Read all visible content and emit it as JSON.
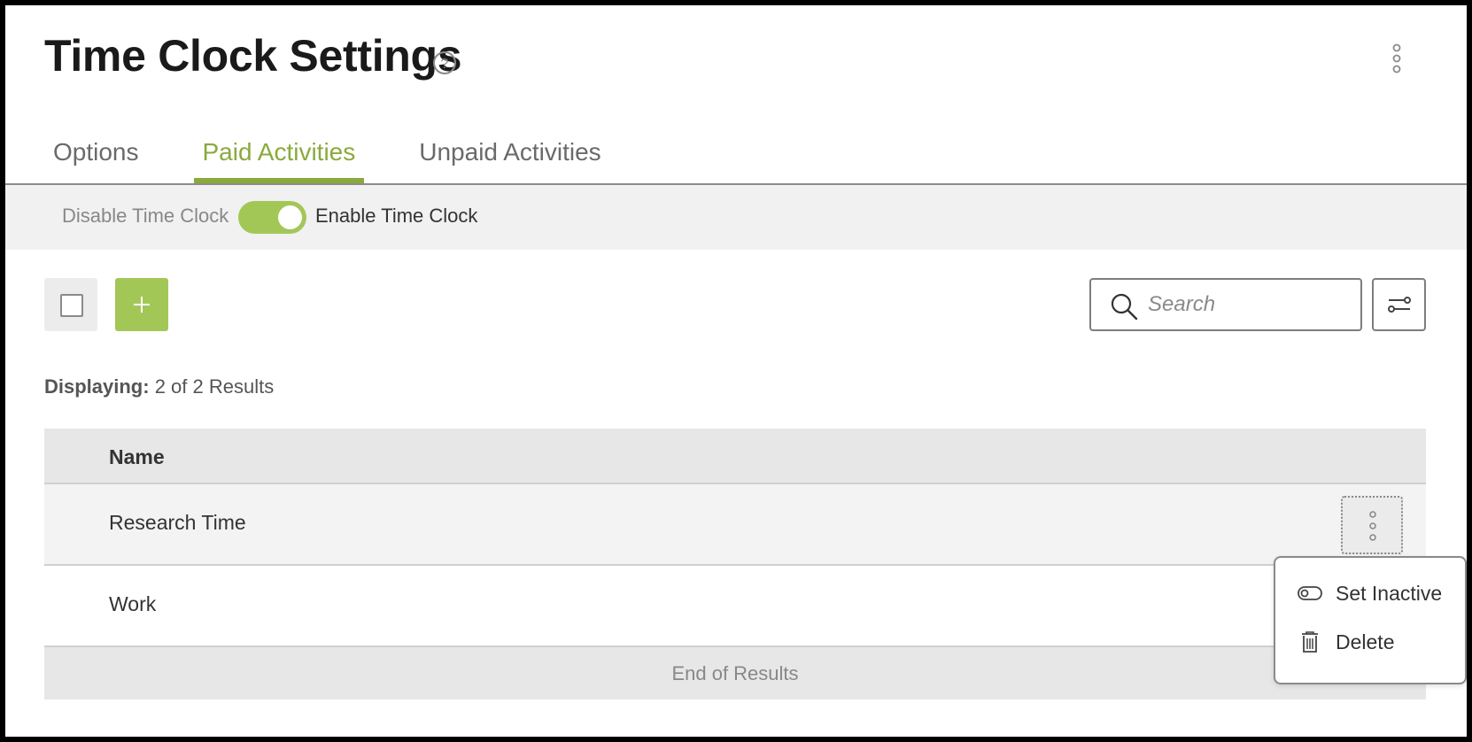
{
  "header": {
    "title": "Time Clock Settings"
  },
  "tabs": [
    {
      "label": "Options",
      "active": false
    },
    {
      "label": "Paid Activities",
      "active": true
    },
    {
      "label": "Unpaid Activities",
      "active": false
    }
  ],
  "time_clock_toggle": {
    "off_label": "Disable Time Clock",
    "on_label": "Enable Time Clock",
    "enabled": true
  },
  "search": {
    "placeholder": "Search",
    "value": ""
  },
  "results": {
    "label": "Displaying:",
    "summary": "2 of 2 Results"
  },
  "table": {
    "columns": [
      "Name"
    ],
    "rows": [
      {
        "name": "Research Time"
      },
      {
        "name": "Work"
      }
    ],
    "footer": "End of Results"
  },
  "context_menu": {
    "items": [
      {
        "label": "Set Inactive",
        "icon": "toggle-off-icon"
      },
      {
        "label": "Delete",
        "icon": "trash-icon"
      }
    ]
  },
  "colors": {
    "accent": "#a3c757",
    "tab_active": "#8aaa3c"
  }
}
